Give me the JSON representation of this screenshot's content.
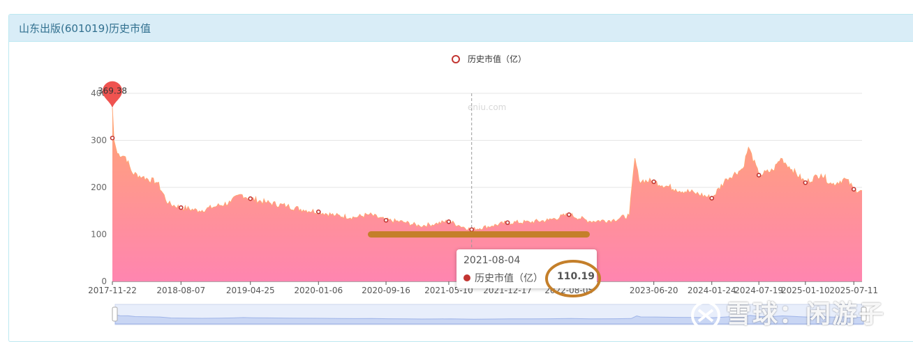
{
  "panel": {
    "title": "山东出版(601019)历史市值"
  },
  "tooltip": {
    "date": "2021-08-04",
    "series_name": "历史市值（亿）",
    "value": "110.19"
  },
  "watermark": {
    "site": "eniu.com",
    "brand": "雪球：闲游子"
  },
  "colors": {
    "series": "#c23531",
    "area_top": "#ffa574",
    "area_bottom": "#ff85b0",
    "highlight": "#c47f2a",
    "pin": "#ef5350"
  },
  "chart_data": {
    "type": "area",
    "title": "",
    "xlabel": "",
    "ylabel": "",
    "ylim": [
      0,
      400
    ],
    "yticks": [
      "0",
      "100",
      "200",
      "300",
      "400"
    ],
    "x_start": "2017-11-22",
    "x_end": "2025-08-11",
    "xtick_labels": [
      {
        "date": "2017-11-22",
        "label": "2017-11-22"
      },
      {
        "date": "2018-08-07",
        "label": "2018-08-07"
      },
      {
        "date": "2019-04-25",
        "label": "2019-04-25"
      },
      {
        "date": "2020-01-06",
        "label": "2020-01-06"
      },
      {
        "date": "2020-09-16",
        "label": "2020-09-16"
      },
      {
        "date": "2021-05-10",
        "label": "2021-05-10"
      },
      {
        "date": "2021-12-17",
        "label": "2021-12-17"
      },
      {
        "date": "2022-08-05",
        "label": "2022-08-05"
      },
      {
        "date": "2023-06-20",
        "label": "2023-06-20"
      },
      {
        "date": "2024-01-24",
        "label": "2024-01-24"
      },
      {
        "date": "2024-07-19",
        "label": "2024-07-19"
      },
      {
        "date": "2025-01-10",
        "label": "2025-01-10"
      },
      {
        "date": "2025-07-11",
        "label": "2025-07-11"
      }
    ],
    "legend": {
      "position": "top-center",
      "label": "历史市值（亿）"
    },
    "grid": true,
    "series": [
      {
        "name": "历史市值（亿）",
        "values": [
          [
            "2017-11-22",
            369.38
          ],
          [
            "2017-11-28",
            300
          ],
          [
            "2017-12-10",
            272
          ],
          [
            "2018-01-10",
            265
          ],
          [
            "2018-02-05",
            230
          ],
          [
            "2018-03-15",
            222
          ],
          [
            "2018-05-10",
            210
          ],
          [
            "2018-06-20",
            165
          ],
          [
            "2018-08-07",
            157
          ],
          [
            "2018-10-15",
            150
          ],
          [
            "2018-12-20",
            160
          ],
          [
            "2019-02-10",
            168
          ],
          [
            "2019-03-20",
            185
          ],
          [
            "2019-04-25",
            176
          ],
          [
            "2019-06-20",
            168
          ],
          [
            "2019-09-10",
            160
          ],
          [
            "2019-11-10",
            152
          ],
          [
            "2020-01-06",
            148
          ],
          [
            "2020-03-10",
            140
          ],
          [
            "2020-05-20",
            136
          ],
          [
            "2020-07-15",
            142
          ],
          [
            "2020-09-16",
            130
          ],
          [
            "2020-11-20",
            126
          ],
          [
            "2021-01-20",
            118
          ],
          [
            "2021-03-20",
            122
          ],
          [
            "2021-05-10",
            128
          ],
          [
            "2021-06-20",
            118
          ],
          [
            "2021-08-04",
            110.19
          ],
          [
            "2021-10-20",
            118
          ],
          [
            "2021-12-17",
            125
          ],
          [
            "2022-03-10",
            126
          ],
          [
            "2022-05-20",
            130
          ],
          [
            "2022-08-05",
            142
          ],
          [
            "2022-10-20",
            128
          ],
          [
            "2023-01-15",
            130
          ],
          [
            "2023-03-20",
            140
          ],
          [
            "2023-04-10",
            262
          ],
          [
            "2023-04-25",
            215
          ],
          [
            "2023-06-20",
            212
          ],
          [
            "2023-09-10",
            196
          ],
          [
            "2023-11-20",
            188
          ],
          [
            "2024-01-24",
            177
          ],
          [
            "2024-03-20",
            218
          ],
          [
            "2024-05-20",
            240
          ],
          [
            "2024-06-10",
            285
          ],
          [
            "2024-07-19",
            226
          ],
          [
            "2024-09-10",
            236
          ],
          [
            "2024-10-10",
            262
          ],
          [
            "2024-11-20",
            238
          ],
          [
            "2025-01-10",
            210
          ],
          [
            "2025-03-10",
            228
          ],
          [
            "2025-04-20",
            206
          ],
          [
            "2025-06-10",
            218
          ],
          [
            "2025-07-11",
            196
          ],
          [
            "2025-08-11",
            193
          ]
        ]
      }
    ],
    "markers": [
      {
        "date": "2017-11-22",
        "value": 305
      },
      {
        "date": "2018-08-07",
        "value": 157
      },
      {
        "date": "2019-04-25",
        "value": 176
      },
      {
        "date": "2020-01-06",
        "value": 148
      },
      {
        "date": "2020-09-16",
        "value": 130
      },
      {
        "date": "2021-05-10",
        "value": 127
      },
      {
        "date": "2021-08-04",
        "value": 110.19
      },
      {
        "date": "2021-12-17",
        "value": 125
      },
      {
        "date": "2022-08-05",
        "value": 142
      },
      {
        "date": "2023-06-20",
        "value": 212
      },
      {
        "date": "2024-01-24",
        "value": 177
      },
      {
        "date": "2024-07-19",
        "value": 226
      },
      {
        "date": "2025-01-10",
        "value": 210
      },
      {
        "date": "2025-07-11",
        "value": 196
      }
    ],
    "max_pin": {
      "date": "2017-11-22",
      "value": 369.38,
      "label": "369.38"
    },
    "hover_date": "2021-08-04"
  }
}
